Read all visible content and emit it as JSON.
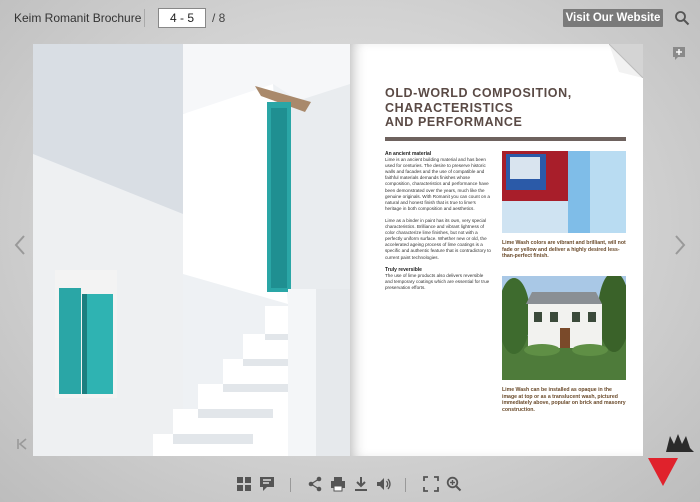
{
  "header": {
    "title": "Keim Romanit Brochure",
    "page_value": "4 - 5",
    "page_total": "/ 8",
    "visit_label": "Visit Our Website"
  },
  "right_page": {
    "heading_line1": "OLD-WORLD COMPOSITION,",
    "heading_line2": "CHARACTERISTICS",
    "heading_line3": "AND PERFORMANCE",
    "section1_title": "An ancient material",
    "section1_body": "Lime is an ancient building material and has been used for centuries. The desire to preserve historic walls and facades and the use of compatible and faithful materials demands finishes whose composition, characteristics and performance have been demonstrated over the years, much like the genuine originals. With Romanit you can count on a natural and honest finish that is true to lime's heritage in both composition and aesthetics.",
    "section2_body": "Lime as a binder in paint has its own, very special characteristics. Brilliance and vibrant lightness of color characterize lime finishes, but not with a perfectly uniform surface. Whether new or old, the accelerated ageing process of lime coatings is a specific and authentic feature that is contradictory to current paint technologies.",
    "section3_title": "Truly reversible",
    "section3_body": "The use of lime products also delivers reversible and temporary coatings which are essential for true preservation efforts.",
    "caption1": "Lime Wash colors are vibrant and brilliant, will not fade or yellow and deliver a highly desired less-than-perfect finish.",
    "caption2": "Lime Wash can be installed as opaque in the image at top or as a translucent wash, pictured immediately above, popular on brick and masonry construction."
  },
  "icons": {
    "search": "search-icon",
    "prev": "chevron-left-icon",
    "next": "chevron-right-icon",
    "first": "first-page-icon",
    "bookmark": "bookmark-add-icon"
  },
  "colors": {
    "accent_heading": "#5a4a45",
    "caption_text": "#6a4a2a",
    "turquoise": "#2aa6a6",
    "brand_red": "#e0222c"
  }
}
